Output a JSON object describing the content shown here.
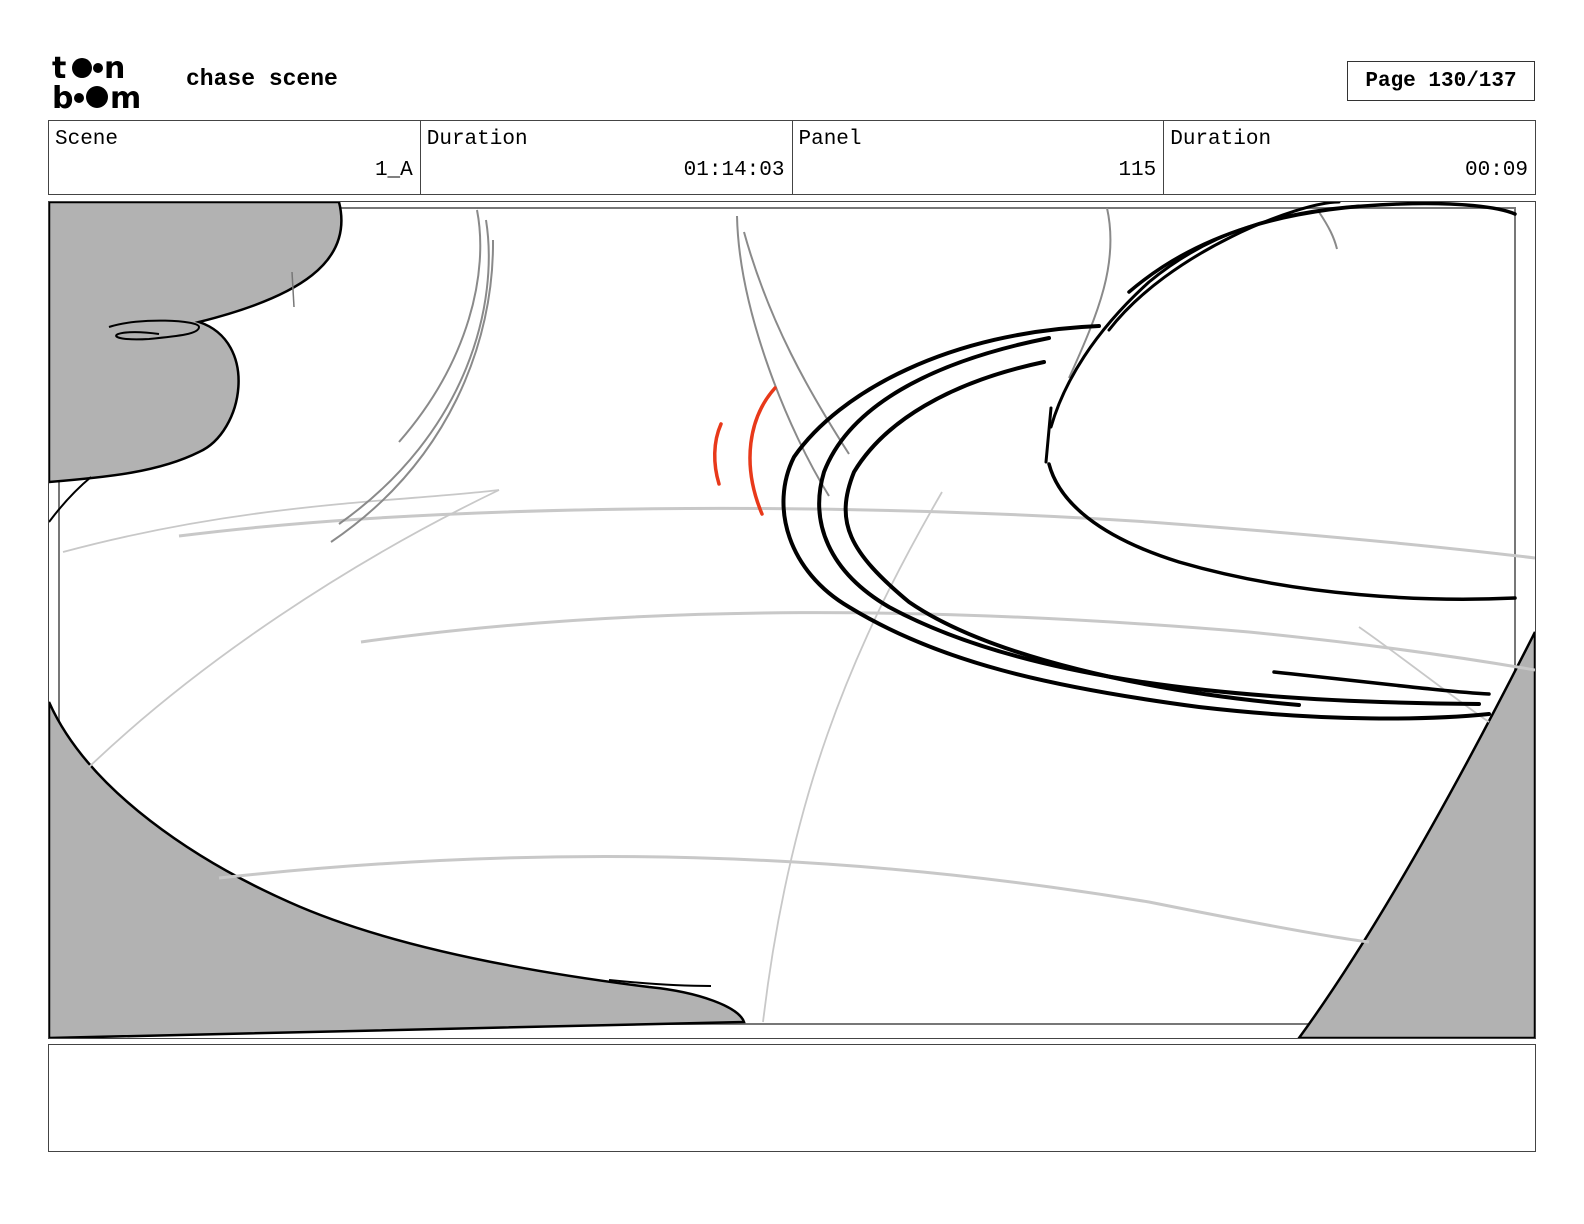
{
  "header": {
    "logo_text": "toon boom",
    "title": "chase scene",
    "page_label": "Page 130/137"
  },
  "info": [
    {
      "label": "Scene",
      "value": "1_A"
    },
    {
      "label": "Duration",
      "value": "01:14:03"
    },
    {
      "label": "Panel",
      "value": "115"
    },
    {
      "label": "Duration",
      "value": "00:09"
    }
  ],
  "colors": {
    "shadow_fill": "#b2b2b2",
    "ink": "#000000",
    "sketch_gray": "#c8c8c8",
    "accent_red": "#e8391a"
  },
  "caption": ""
}
